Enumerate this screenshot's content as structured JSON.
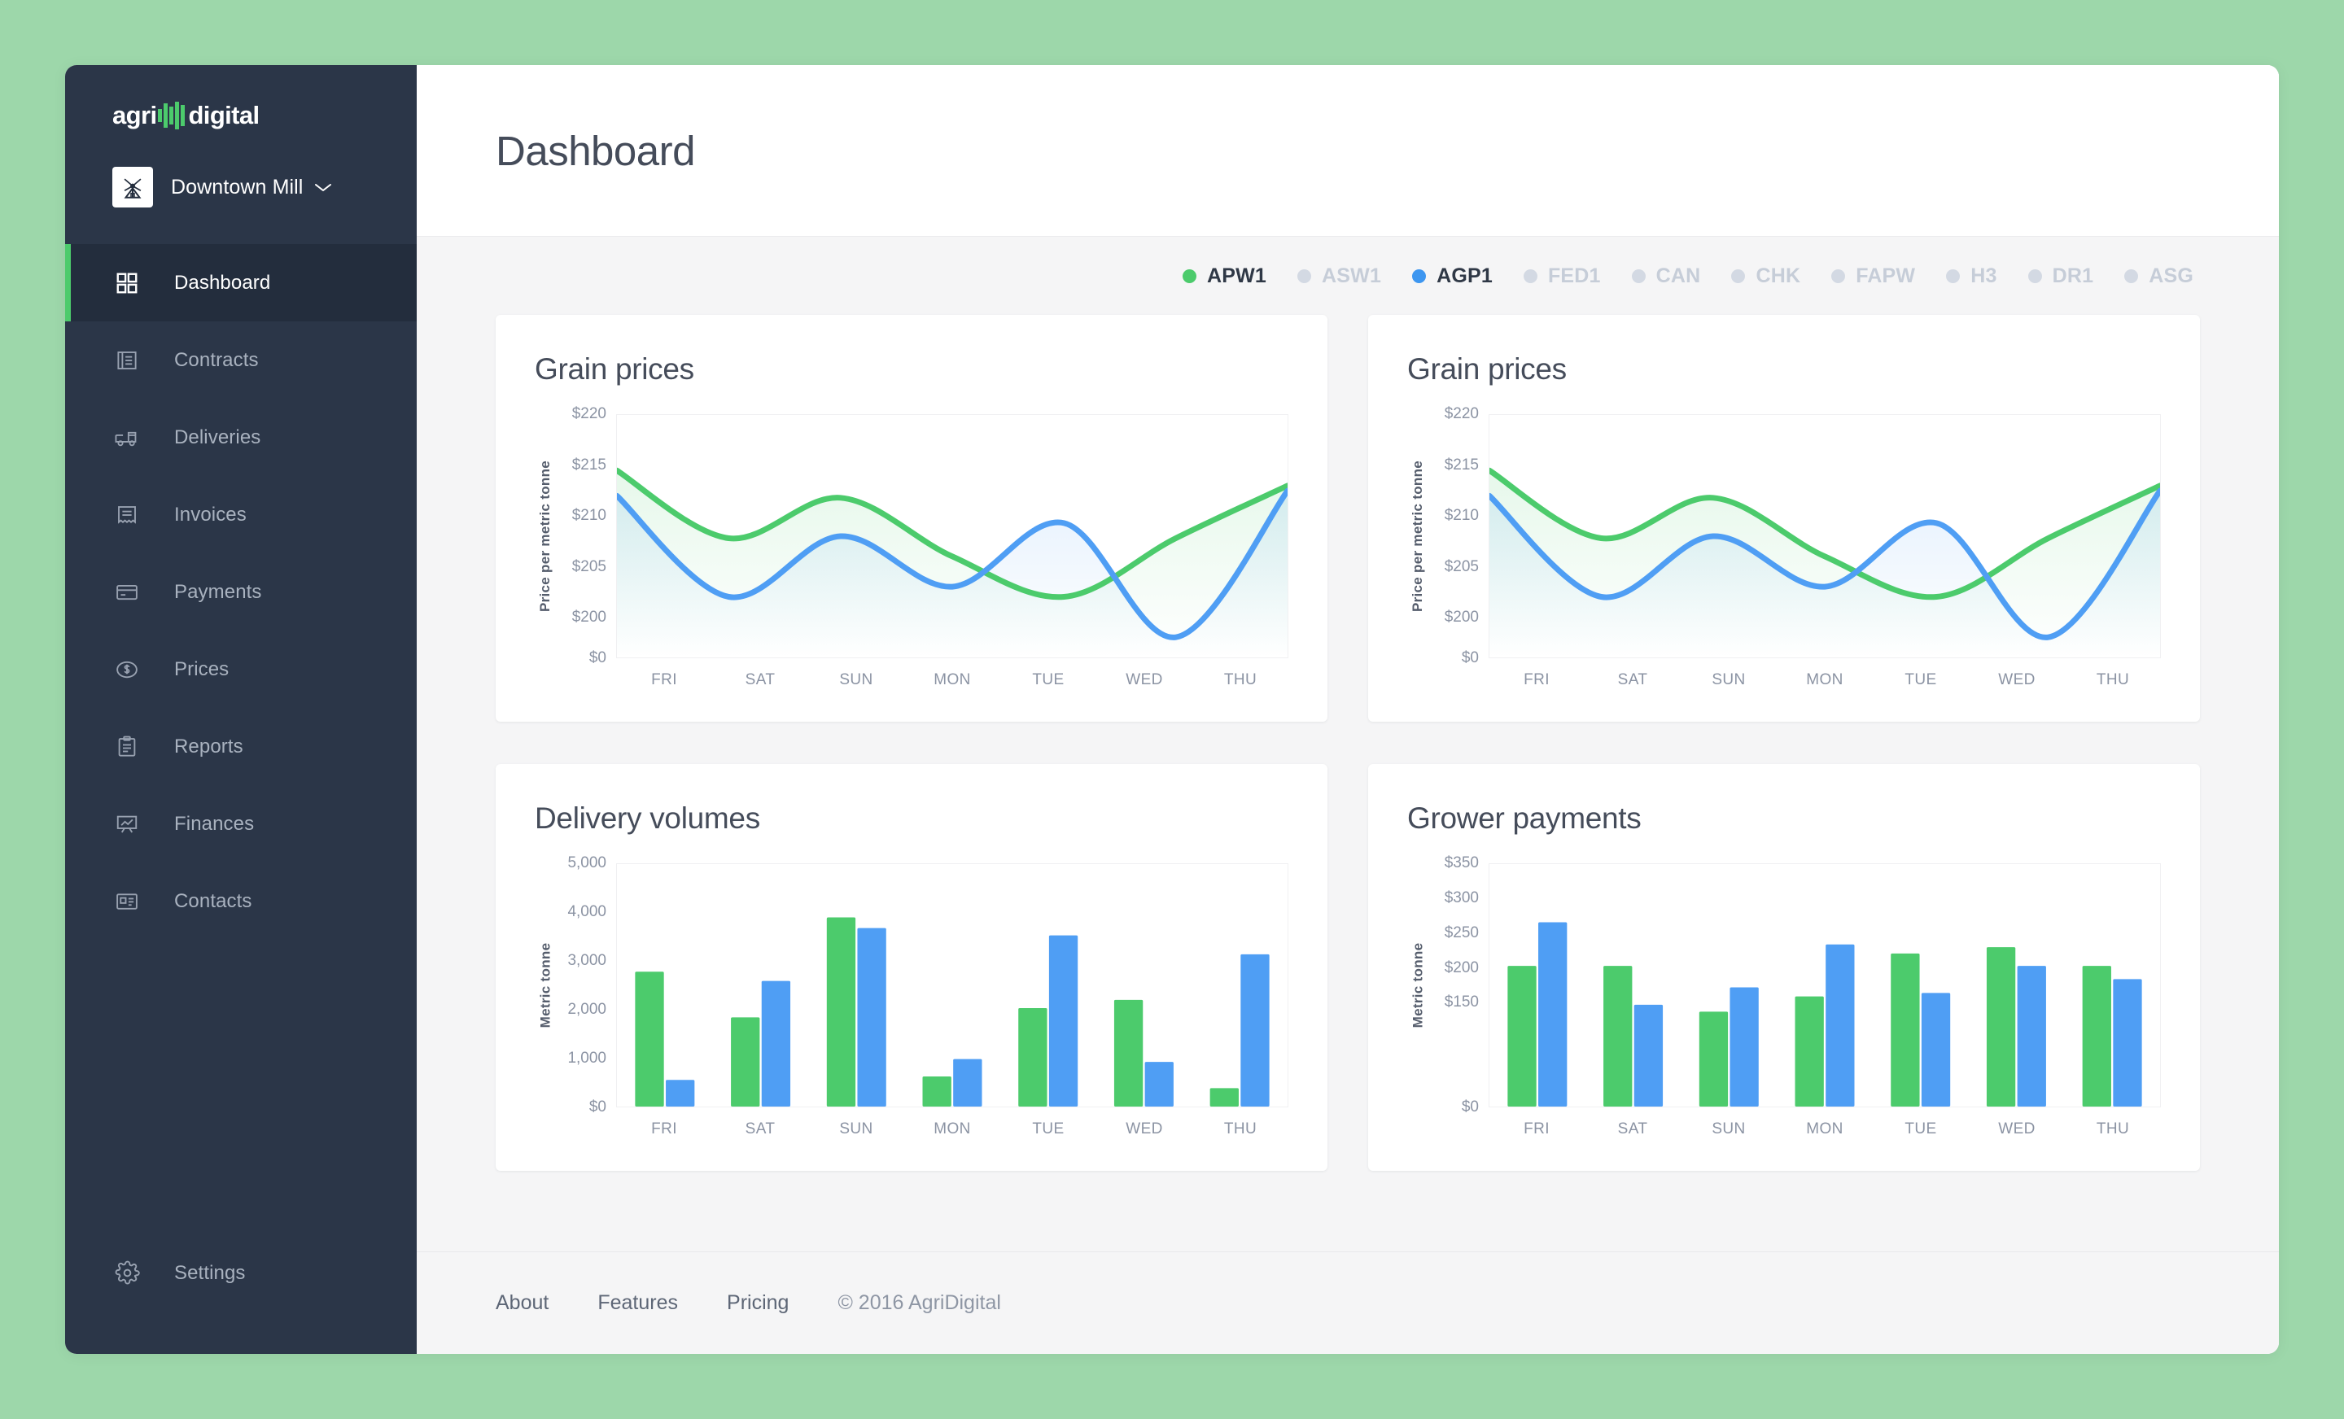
{
  "brand": {
    "name_left": "agri",
    "name_right": "digital"
  },
  "org": {
    "name": "Downtown Mill",
    "avatar_icon": "windmill-icon",
    "caret_icon": "chevron-down-icon"
  },
  "sidebar": {
    "items": [
      {
        "label": "Dashboard",
        "icon": "grid-icon",
        "active": true
      },
      {
        "label": "Contracts",
        "icon": "document-list-icon",
        "active": false
      },
      {
        "label": "Deliveries",
        "icon": "truck-icon",
        "active": false
      },
      {
        "label": "Invoices",
        "icon": "receipt-icon",
        "active": false
      },
      {
        "label": "Payments",
        "icon": "credit-card-icon",
        "active": false
      },
      {
        "label": "Prices",
        "icon": "dollar-circle-icon",
        "active": false
      },
      {
        "label": "Reports",
        "icon": "clipboard-icon",
        "active": false
      },
      {
        "label": "Finances",
        "icon": "presentation-chart-icon",
        "active": false
      },
      {
        "label": "Contacts",
        "icon": "contact-card-icon",
        "active": false
      }
    ],
    "settings": {
      "label": "Settings",
      "icon": "gear-icon"
    }
  },
  "header": {
    "title": "Dashboard"
  },
  "legend": {
    "items": [
      {
        "label": "APW1",
        "active": true,
        "color": "#4ccb6c"
      },
      {
        "label": "ASW1",
        "active": false,
        "color": "#d3d9e3"
      },
      {
        "label": "AGP1",
        "active": true,
        "color": "#3d96f0"
      },
      {
        "label": "FED1",
        "active": false,
        "color": "#d3d9e3"
      },
      {
        "label": "CAN",
        "active": false,
        "color": "#d3d9e3"
      },
      {
        "label": "CHK",
        "active": false,
        "color": "#d3d9e3"
      },
      {
        "label": "FAPW",
        "active": false,
        "color": "#d3d9e3"
      },
      {
        "label": "H3",
        "active": false,
        "color": "#d3d9e3"
      },
      {
        "label": "DR1",
        "active": false,
        "color": "#d3d9e3"
      },
      {
        "label": "ASG",
        "active": false,
        "color": "#d3d9e3"
      }
    ]
  },
  "cards": {
    "grain_prices_left": {
      "title": "Grain prices"
    },
    "grain_prices_right": {
      "title": "Grain prices"
    },
    "delivery_volumes": {
      "title": "Delivery volumes"
    },
    "grower_payments": {
      "title": "Grower payments"
    }
  },
  "footer": {
    "links": [
      "About",
      "Features",
      "Pricing"
    ],
    "copyright": "© 2016 AgriDigital"
  },
  "colors": {
    "green": "#4ccb6c",
    "blue": "#4f9ef4",
    "sidebar_bg": "#2b3648",
    "sidebar_active_bg": "#232d3d",
    "page_bg": "#9dd7aa",
    "content_bg": "#f5f5f6",
    "title_text": "#454c5a",
    "axis_text": "#8b93a3"
  },
  "chart_data": [
    {
      "id": "grain-prices-left",
      "type": "line",
      "title": "Grain prices",
      "xlabel": "",
      "ylabel": "Price per metric tonne",
      "x": [
        "FRI",
        "SAT",
        "SUN",
        "MON",
        "TUE",
        "WED",
        "THU"
      ],
      "ytick_labels": [
        "$220",
        "$215",
        "$210",
        "$205",
        "$200",
        "$0"
      ],
      "ytick_values": [
        220,
        215,
        210,
        205,
        200,
        0
      ],
      "ylim": [
        196,
        220
      ],
      "grid": false,
      "legend_position": "top-right-shared",
      "series": [
        {
          "name": "APW1",
          "color": "#4ccb6c",
          "values": [
            214.5,
            207.8,
            211.8,
            206.0,
            202.0,
            207.8,
            213.0
          ]
        },
        {
          "name": "AGP1",
          "color": "#4f9ef4",
          "values": [
            212.0,
            202.0,
            208.0,
            203.0,
            209.3,
            198.0,
            212.5
          ]
        }
      ]
    },
    {
      "id": "grain-prices-right",
      "type": "line",
      "title": "Grain prices",
      "xlabel": "",
      "ylabel": "Price per metric tonne",
      "x": [
        "FRI",
        "SAT",
        "SUN",
        "MON",
        "TUE",
        "WED",
        "THU"
      ],
      "ytick_labels": [
        "$220",
        "$215",
        "$210",
        "$205",
        "$200",
        "$0"
      ],
      "ytick_values": [
        220,
        215,
        210,
        205,
        200,
        0
      ],
      "ylim": [
        196,
        220
      ],
      "grid": false,
      "legend_position": "top-right-shared",
      "series": [
        {
          "name": "APW1",
          "color": "#4ccb6c",
          "values": [
            214.5,
            207.8,
            211.8,
            206.0,
            202.0,
            207.8,
            213.0
          ]
        },
        {
          "name": "AGP1",
          "color": "#4f9ef4",
          "values": [
            212.0,
            202.0,
            208.0,
            203.0,
            209.3,
            198.0,
            212.5
          ]
        }
      ]
    },
    {
      "id": "delivery-volumes",
      "type": "bar",
      "title": "Delivery volumes",
      "xlabel": "",
      "ylabel": "Metric tonne",
      "categories": [
        "FRI",
        "SAT",
        "SUN",
        "MON",
        "TUE",
        "WED",
        "THU"
      ],
      "ytick_labels": [
        "5,000",
        "4,000",
        "3,000",
        "2,000",
        "1,000",
        "$0"
      ],
      "ytick_values": [
        5000,
        4000,
        3000,
        2000,
        1000,
        0
      ],
      "ylim": [
        0,
        5000
      ],
      "grid": false,
      "series": [
        {
          "name": "APW1",
          "color": "#4ccb6c",
          "values": [
            2780,
            1840,
            3900,
            620,
            2030,
            2200,
            380
          ]
        },
        {
          "name": "AGP1",
          "color": "#4f9ef4",
          "values": [
            550,
            2590,
            3680,
            980,
            3530,
            920,
            3140
          ]
        }
      ]
    },
    {
      "id": "grower-payments",
      "type": "bar",
      "title": "Grower payments",
      "xlabel": "",
      "ylabel": "Metric tonne",
      "categories": [
        "FRI",
        "SAT",
        "SUN",
        "MON",
        "TUE",
        "WED",
        "THU"
      ],
      "ytick_labels": [
        "$350",
        "$300",
        "$250",
        "$200",
        "$150",
        "$0"
      ],
      "ytick_values": [
        350,
        300,
        250,
        200,
        150,
        0
      ],
      "ylim": [
        0,
        350
      ],
      "grid": false,
      "series": [
        {
          "name": "APW1",
          "color": "#4ccb6c",
          "values": [
            203,
            203,
            137,
            159,
            221,
            230,
            203
          ]
        },
        {
          "name": "AGP1",
          "color": "#4f9ef4",
          "values": [
            266,
            147,
            172,
            234,
            164,
            203,
            184
          ]
        }
      ]
    }
  ]
}
